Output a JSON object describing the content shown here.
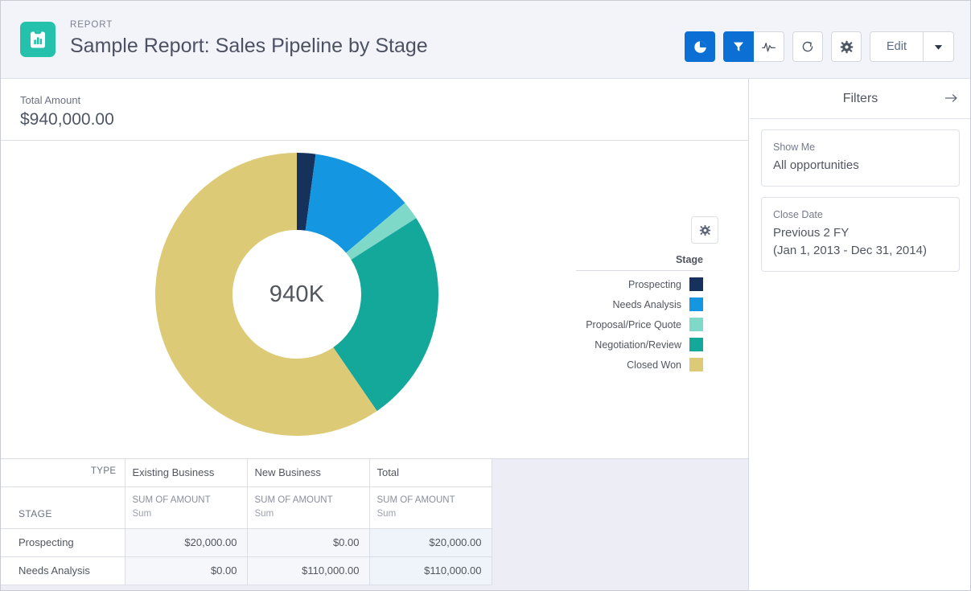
{
  "header": {
    "eyebrow": "REPORT",
    "title": "Sample Report: Sales Pipeline by Stage",
    "report_icon": "report-clipboard-icon",
    "actions": {
      "chart_toggle_label": "chart-icon",
      "filter_toggle_label": "funnel-icon",
      "pulse_label": "pulse-icon",
      "refresh_label": "refresh-icon",
      "settings_label": "gear-icon",
      "edit_label": "Edit",
      "edit_caret_label": "chevron-down-icon"
    }
  },
  "summary": {
    "label": "Total Amount",
    "value": "$940,000.00"
  },
  "chart_data": {
    "type": "pie",
    "title": "",
    "legend_title": "Stage",
    "legend_position": "right",
    "center_label": "940K",
    "total": 940000,
    "unit": "USD",
    "categories": [
      "Prospecting",
      "Needs Analysis",
      "Proposal/Price Quote",
      "Negotiation/Review",
      "Closed Won"
    ],
    "values": [
      20000,
      110000,
      20000,
      230000,
      560000
    ],
    "percents": [
      2.1,
      11.7,
      2.1,
      24.5,
      59.6
    ],
    "colors": [
      "#16325c",
      "#1496e0",
      "#7fd9c8",
      "#14a89a",
      "#ddca77"
    ]
  },
  "chart_gear_label": "gear-icon",
  "table": {
    "corner_type_label": "TYPE",
    "corner_stage_label": "STAGE",
    "columns": [
      "Existing Business",
      "New Business",
      "Total"
    ],
    "measure_line1": "SUM OF AMOUNT",
    "measure_line2": "Sum",
    "rows": [
      {
        "stage": "Prospecting",
        "values": [
          "$20,000.00",
          "$0.00",
          "$20,000.00"
        ]
      },
      {
        "stage": "Needs Analysis",
        "values": [
          "$0.00",
          "$110,000.00",
          "$110,000.00"
        ]
      }
    ]
  },
  "filters": {
    "title": "Filters",
    "collapse_label": "arrow-right-icon",
    "cards": [
      {
        "name": "Show Me",
        "value": "All opportunities"
      },
      {
        "name": "Close Date",
        "value": "Previous 2 FY\n(Jan 1, 2013 - Dec 31, 2014)"
      }
    ]
  },
  "scrollbar": {
    "up_label": "scroll-up-arrow-icon"
  }
}
